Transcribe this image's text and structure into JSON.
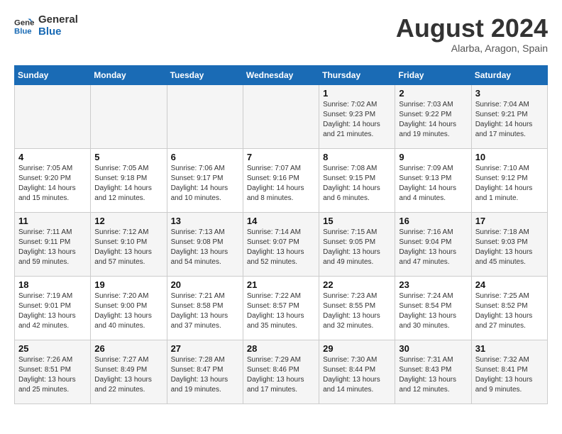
{
  "logo": {
    "line1": "General",
    "line2": "Blue"
  },
  "title": "August 2024",
  "location": "Alarba, Aragon, Spain",
  "weekdays": [
    "Sunday",
    "Monday",
    "Tuesday",
    "Wednesday",
    "Thursday",
    "Friday",
    "Saturday"
  ],
  "weeks": [
    [
      {
        "day": "",
        "info": ""
      },
      {
        "day": "",
        "info": ""
      },
      {
        "day": "",
        "info": ""
      },
      {
        "day": "",
        "info": ""
      },
      {
        "day": "1",
        "info": "Sunrise: 7:02 AM\nSunset: 9:23 PM\nDaylight: 14 hours\nand 21 minutes."
      },
      {
        "day": "2",
        "info": "Sunrise: 7:03 AM\nSunset: 9:22 PM\nDaylight: 14 hours\nand 19 minutes."
      },
      {
        "day": "3",
        "info": "Sunrise: 7:04 AM\nSunset: 9:21 PM\nDaylight: 14 hours\nand 17 minutes."
      }
    ],
    [
      {
        "day": "4",
        "info": "Sunrise: 7:05 AM\nSunset: 9:20 PM\nDaylight: 14 hours\nand 15 minutes."
      },
      {
        "day": "5",
        "info": "Sunrise: 7:05 AM\nSunset: 9:18 PM\nDaylight: 14 hours\nand 12 minutes."
      },
      {
        "day": "6",
        "info": "Sunrise: 7:06 AM\nSunset: 9:17 PM\nDaylight: 14 hours\nand 10 minutes."
      },
      {
        "day": "7",
        "info": "Sunrise: 7:07 AM\nSunset: 9:16 PM\nDaylight: 14 hours\nand 8 minutes."
      },
      {
        "day": "8",
        "info": "Sunrise: 7:08 AM\nSunset: 9:15 PM\nDaylight: 14 hours\nand 6 minutes."
      },
      {
        "day": "9",
        "info": "Sunrise: 7:09 AM\nSunset: 9:13 PM\nDaylight: 14 hours\nand 4 minutes."
      },
      {
        "day": "10",
        "info": "Sunrise: 7:10 AM\nSunset: 9:12 PM\nDaylight: 14 hours\nand 1 minute."
      }
    ],
    [
      {
        "day": "11",
        "info": "Sunrise: 7:11 AM\nSunset: 9:11 PM\nDaylight: 13 hours\nand 59 minutes."
      },
      {
        "day": "12",
        "info": "Sunrise: 7:12 AM\nSunset: 9:10 PM\nDaylight: 13 hours\nand 57 minutes."
      },
      {
        "day": "13",
        "info": "Sunrise: 7:13 AM\nSunset: 9:08 PM\nDaylight: 13 hours\nand 54 minutes."
      },
      {
        "day": "14",
        "info": "Sunrise: 7:14 AM\nSunset: 9:07 PM\nDaylight: 13 hours\nand 52 minutes."
      },
      {
        "day": "15",
        "info": "Sunrise: 7:15 AM\nSunset: 9:05 PM\nDaylight: 13 hours\nand 49 minutes."
      },
      {
        "day": "16",
        "info": "Sunrise: 7:16 AM\nSunset: 9:04 PM\nDaylight: 13 hours\nand 47 minutes."
      },
      {
        "day": "17",
        "info": "Sunrise: 7:18 AM\nSunset: 9:03 PM\nDaylight: 13 hours\nand 45 minutes."
      }
    ],
    [
      {
        "day": "18",
        "info": "Sunrise: 7:19 AM\nSunset: 9:01 PM\nDaylight: 13 hours\nand 42 minutes."
      },
      {
        "day": "19",
        "info": "Sunrise: 7:20 AM\nSunset: 9:00 PM\nDaylight: 13 hours\nand 40 minutes."
      },
      {
        "day": "20",
        "info": "Sunrise: 7:21 AM\nSunset: 8:58 PM\nDaylight: 13 hours\nand 37 minutes."
      },
      {
        "day": "21",
        "info": "Sunrise: 7:22 AM\nSunset: 8:57 PM\nDaylight: 13 hours\nand 35 minutes."
      },
      {
        "day": "22",
        "info": "Sunrise: 7:23 AM\nSunset: 8:55 PM\nDaylight: 13 hours\nand 32 minutes."
      },
      {
        "day": "23",
        "info": "Sunrise: 7:24 AM\nSunset: 8:54 PM\nDaylight: 13 hours\nand 30 minutes."
      },
      {
        "day": "24",
        "info": "Sunrise: 7:25 AM\nSunset: 8:52 PM\nDaylight: 13 hours\nand 27 minutes."
      }
    ],
    [
      {
        "day": "25",
        "info": "Sunrise: 7:26 AM\nSunset: 8:51 PM\nDaylight: 13 hours\nand 25 minutes."
      },
      {
        "day": "26",
        "info": "Sunrise: 7:27 AM\nSunset: 8:49 PM\nDaylight: 13 hours\nand 22 minutes."
      },
      {
        "day": "27",
        "info": "Sunrise: 7:28 AM\nSunset: 8:47 PM\nDaylight: 13 hours\nand 19 minutes."
      },
      {
        "day": "28",
        "info": "Sunrise: 7:29 AM\nSunset: 8:46 PM\nDaylight: 13 hours\nand 17 minutes."
      },
      {
        "day": "29",
        "info": "Sunrise: 7:30 AM\nSunset: 8:44 PM\nDaylight: 13 hours\nand 14 minutes."
      },
      {
        "day": "30",
        "info": "Sunrise: 7:31 AM\nSunset: 8:43 PM\nDaylight: 13 hours\nand 12 minutes."
      },
      {
        "day": "31",
        "info": "Sunrise: 7:32 AM\nSunset: 8:41 PM\nDaylight: 13 hours\nand 9 minutes."
      }
    ]
  ]
}
